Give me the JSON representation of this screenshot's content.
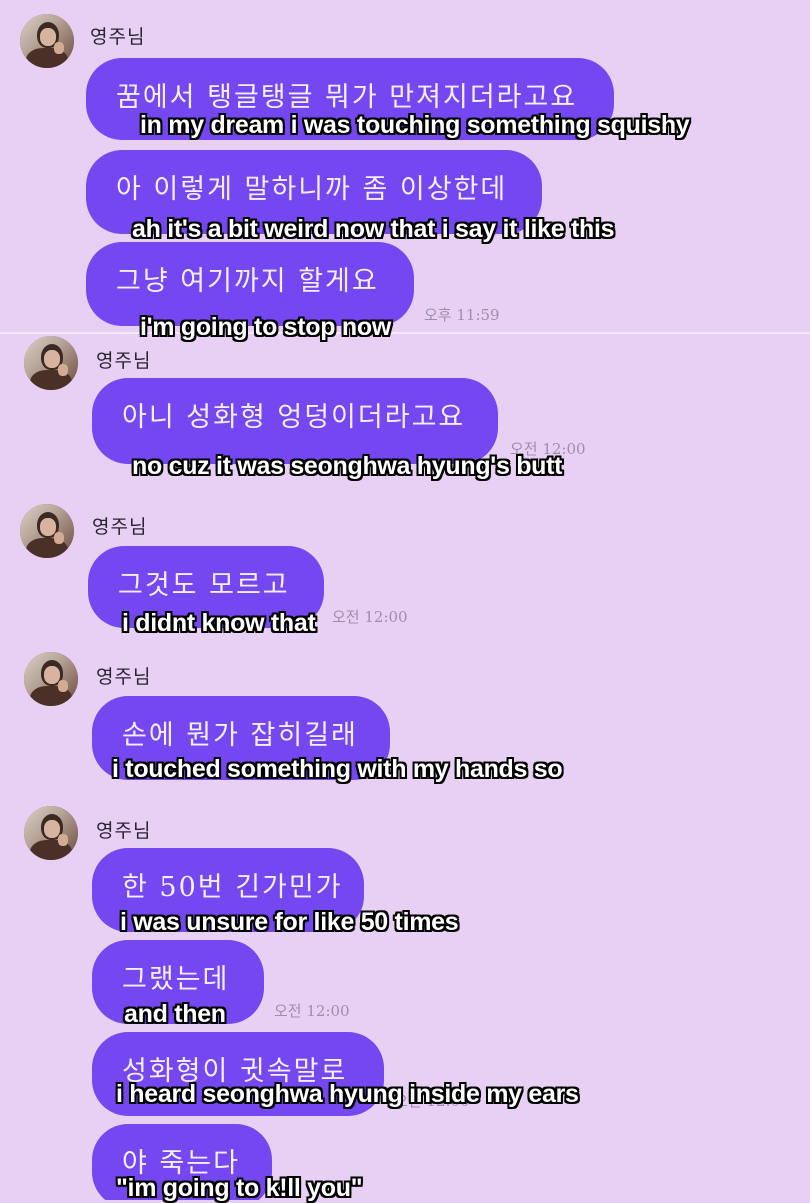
{
  "chat": {
    "sender": "영주님",
    "bubbles": [
      "꿈에서 탱글탱글 뭐가 만져지더라고요",
      "아 이렇게 말하니까 좀 이상한데",
      "그냥 여기까지 할게요",
      "아니 성화형 엉덩이더라고요",
      "그것도 모르고",
      "손에 뭔가 잡히길래",
      "한 50번 긴가민가",
      "그랬는데",
      "성화형이 귓속말로",
      "야 죽는다"
    ],
    "times": [
      "오후 11:59",
      "오전 12:00",
      "오전 12:00",
      "오전 12:00",
      "오전 12:00"
    ]
  },
  "captions": [
    "in my dream i was touching something squishy",
    "ah it's a bit weird now that i say it like this",
    "i'm going to stop now",
    "no cuz it was seonghwa hyung's butt",
    "i didnt know that",
    "i touched something with my hands so",
    "i was unsure for like 50 times",
    "and then",
    "i heard seonghwa hyung inside my ears",
    "\"im going to k!ll you\""
  ]
}
